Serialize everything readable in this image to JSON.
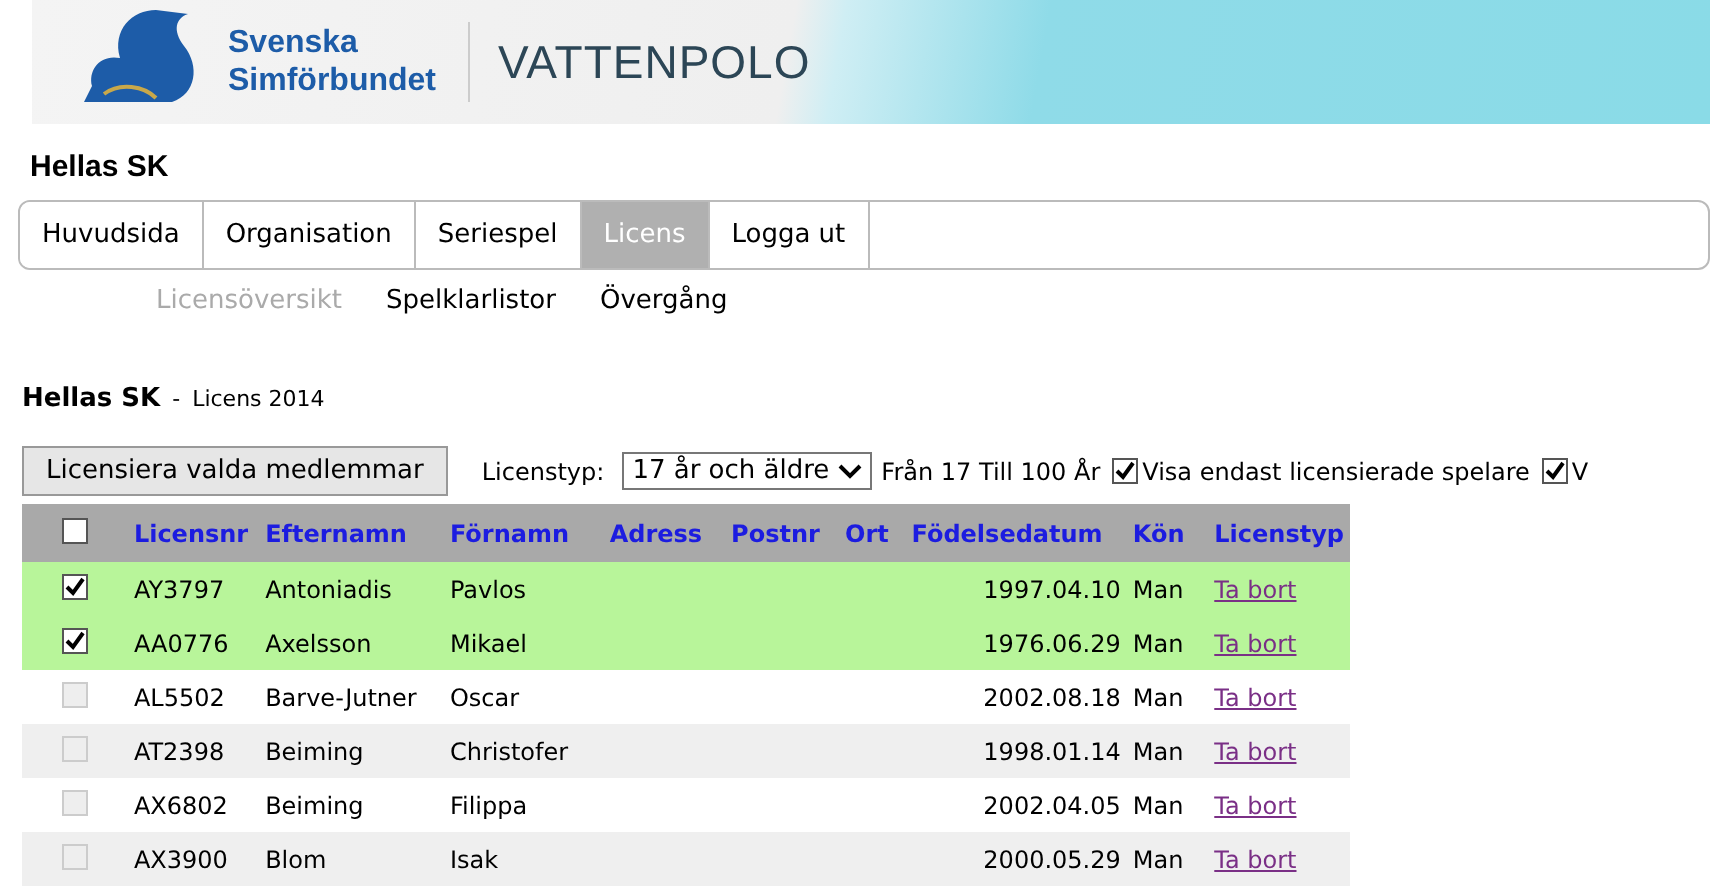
{
  "banner": {
    "org_line_1": "Svenska",
    "org_line_2": "Simförbundet",
    "section": "VATTENPOLO"
  },
  "club": "Hellas SK",
  "tabs": [
    {
      "label": "Huvudsida",
      "selected": false
    },
    {
      "label": "Organisation",
      "selected": false
    },
    {
      "label": "Seriespel",
      "selected": false
    },
    {
      "label": "Licens",
      "selected": true
    },
    {
      "label": "Logga ut",
      "selected": false
    }
  ],
  "subnav": [
    {
      "label": "Licensöversikt",
      "selected": true
    },
    {
      "label": "Spelklarlistor",
      "selected": false
    },
    {
      "label": "Övergång",
      "selected": false
    }
  ],
  "heading": {
    "club": "Hellas SK",
    "separator": "-",
    "subtitle": "Licens 2014"
  },
  "toolbar": {
    "button": "Licensiera valda medlemmar",
    "type_label": "Licenstyp:",
    "type_value": "17 år och äldre",
    "range": "Från 17 Till 100 År",
    "filters": [
      {
        "label": "Visa endast licensierade spelare",
        "checked": true
      },
      {
        "label": "V",
        "checked": true
      }
    ]
  },
  "table": {
    "select_all_checked": false,
    "columns": [
      "Licensnr",
      "Efternamn",
      "Förnamn",
      "Adress",
      "Postnr",
      "Ort",
      "Födelsedatum",
      "Kön",
      "Licenstyp"
    ],
    "rows": [
      {
        "checked": true,
        "disabled": false,
        "cells": [
          "AY3797",
          "Antoniadis",
          "Pavlos",
          "",
          "",
          "",
          "1997.04.10",
          "Man"
        ],
        "action": "Ta bort"
      },
      {
        "checked": true,
        "disabled": false,
        "cells": [
          "AA0776",
          "Axelsson",
          "Mikael",
          "",
          "",
          "",
          "1976.06.29",
          "Man"
        ],
        "action": "Ta bort"
      },
      {
        "checked": false,
        "disabled": true,
        "cells": [
          "AL5502",
          "Barve-Jutner",
          "Oscar",
          "",
          "",
          "",
          "2002.08.18",
          "Man"
        ],
        "action": "Ta bort"
      },
      {
        "checked": false,
        "disabled": true,
        "cells": [
          "AT2398",
          "Beiming",
          "Christofer",
          "",
          "",
          "",
          "1998.01.14",
          "Man"
        ],
        "action": "Ta bort"
      },
      {
        "checked": false,
        "disabled": true,
        "cells": [
          "AX6802",
          "Beiming",
          "Filippa",
          "",
          "",
          "",
          "2002.04.05",
          "Man"
        ],
        "action": "Ta bort"
      },
      {
        "checked": false,
        "disabled": true,
        "cells": [
          "AX3900",
          "Blom",
          "Isak",
          "",
          "",
          "",
          "2000.05.29",
          "Man"
        ],
        "action": "Ta bort"
      }
    ]
  }
}
